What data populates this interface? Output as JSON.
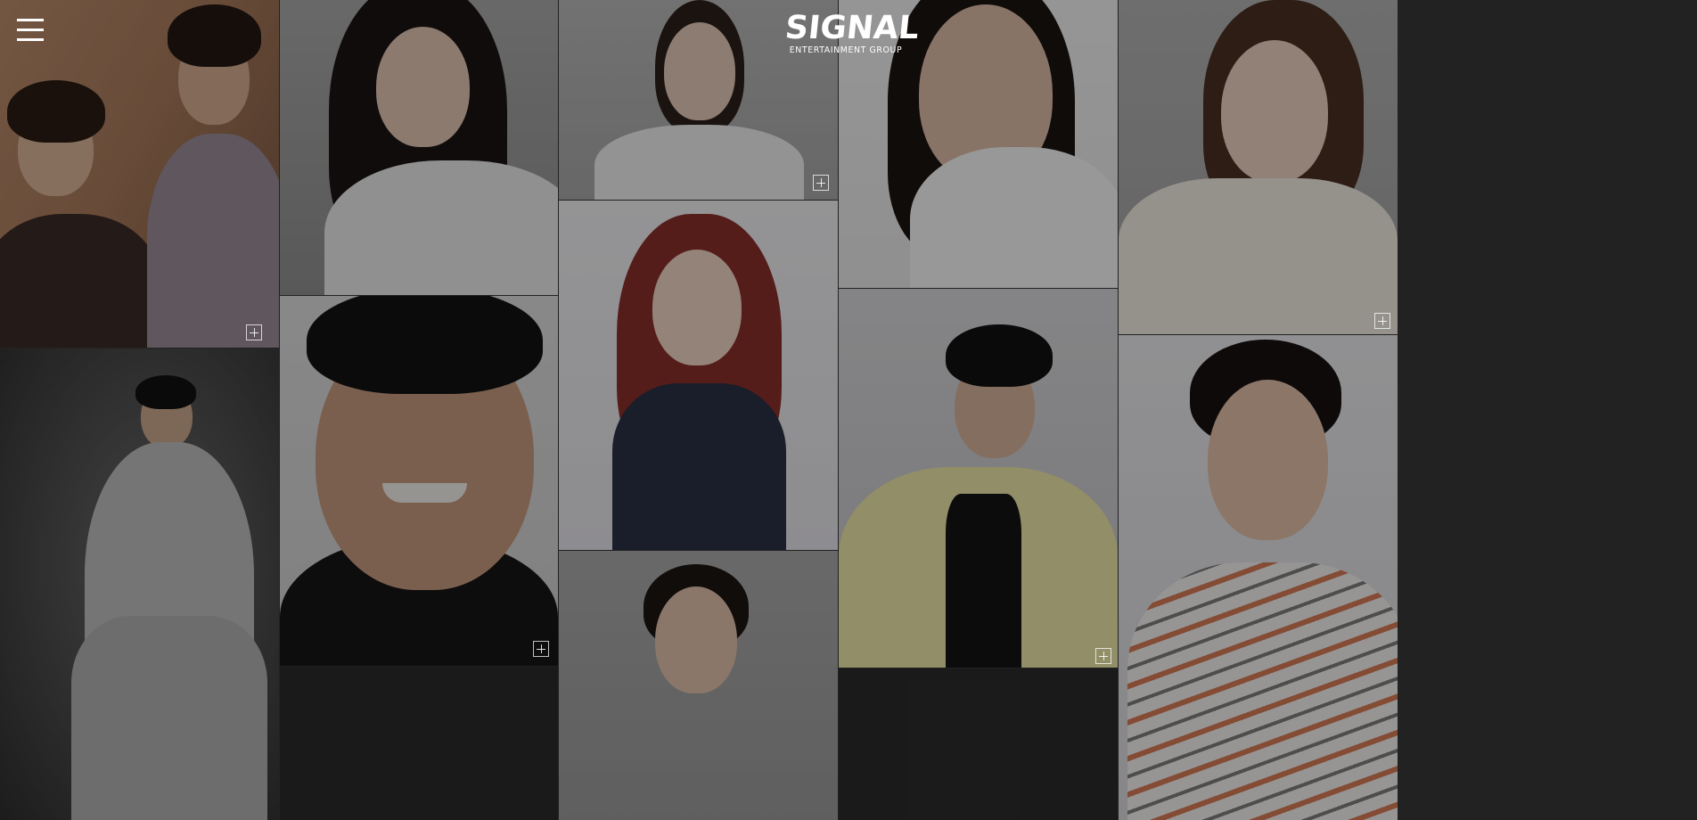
{
  "header": {
    "menu_icon": "hamburger-menu-icon",
    "logo_wordmark": "SIGNAL",
    "logo_tagline": "ENTERTAINMENT GROUP"
  },
  "grid": {
    "more_icon": "plus-square-icon",
    "tiles": [
      {
        "id": "duo-men",
        "has_more": true
      },
      {
        "id": "man-light-suit",
        "has_more": false
      },
      {
        "id": "woman-long-dark-hair",
        "has_more": false
      },
      {
        "id": "smiling-man",
        "has_more": true
      },
      {
        "id": "bottom-strip-1",
        "has_more": false
      },
      {
        "id": "young-woman-white-blouse",
        "has_more": true
      },
      {
        "id": "red-haired-woman",
        "has_more": false
      },
      {
        "id": "woman-updo",
        "has_more": false
      },
      {
        "id": "woman-bob-white-collar",
        "has_more": false
      },
      {
        "id": "man-cap-yellow-jacket",
        "has_more": true
      },
      {
        "id": "bottom-strip-2",
        "has_more": false
      },
      {
        "id": "woman-knit-sweater",
        "has_more": true
      },
      {
        "id": "man-striped-shirt",
        "has_more": false
      }
    ]
  },
  "colors": {
    "overlay": "#000000",
    "background": "#222222",
    "text": "#ffffff"
  }
}
